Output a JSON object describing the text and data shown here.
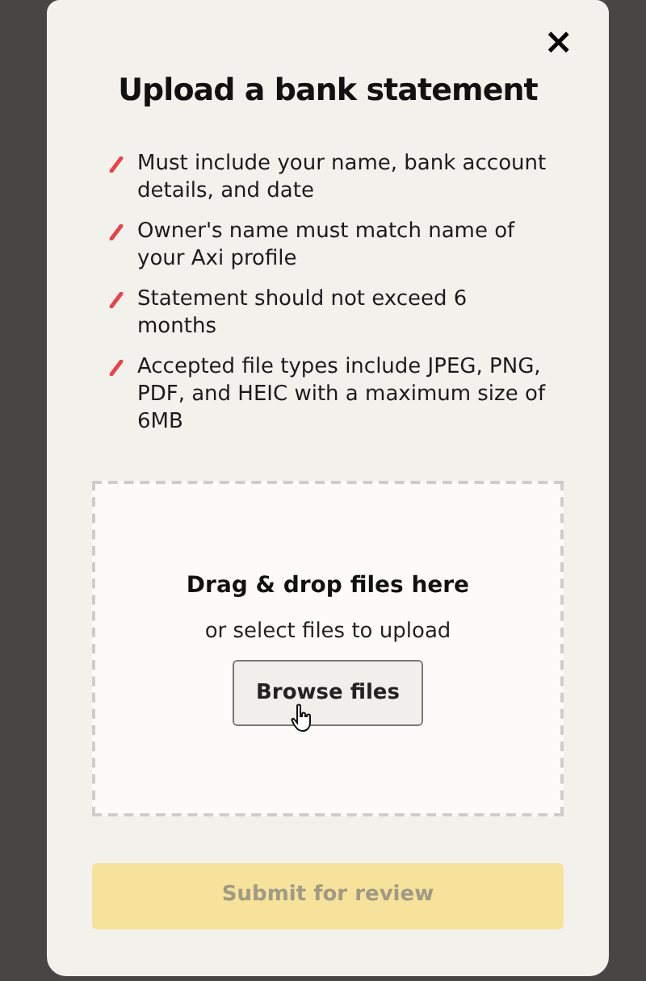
{
  "dialog": {
    "close": "×",
    "title": "Upload a bank statement",
    "requirements": [
      "Must include your name, bank account details, and date",
      "Owner's name must match name of your Axi profile",
      "Statement should not exceed 6 months",
      "Accepted file types include JPEG, PNG, PDF, and HEIC with a maximum size of 6MB"
    ],
    "dropzone": {
      "heading": "Drag & drop files here",
      "subtext": "or select files to upload",
      "button": "Browse files"
    },
    "submit": {
      "label": "Submit for review",
      "disabled": true
    }
  }
}
